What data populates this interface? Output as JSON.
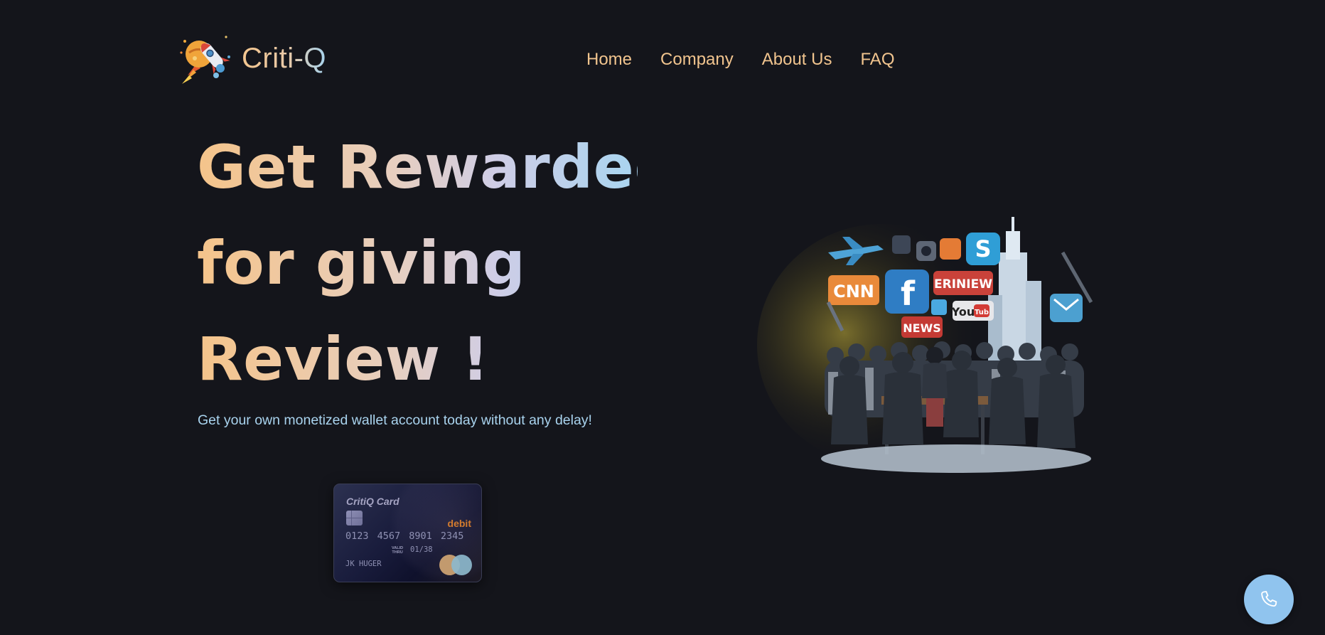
{
  "brand": {
    "name": "Criti-Q",
    "logo_icon": "rocket-logo-icon"
  },
  "nav": {
    "items": [
      {
        "label": "Home"
      },
      {
        "label": "Company"
      },
      {
        "label": "About Us"
      },
      {
        "label": "FAQ"
      }
    ]
  },
  "hero": {
    "title_lines": [
      "Get Rewarded",
      "for giving",
      "Review !"
    ],
    "subtitle": "Get your own monetized wallet account today without any delay!"
  },
  "card": {
    "title": "CritiQ Card",
    "type": "debit",
    "number": "0123 4567 8901 2345",
    "valid_label_line1": "VALID",
    "valid_label_line2": "THRU",
    "valid_thru": "01/38",
    "holder": "JK HUGER"
  },
  "illustration": {
    "signs": [
      "CNN",
      "ERINIEW",
      "NEWS",
      "You",
      "Tub"
    ]
  },
  "call_button": {
    "icon": "phone-icon"
  },
  "colors": {
    "background": "#14151b",
    "accent_peach": "#f1c48e",
    "accent_blue": "#a9d3ee",
    "call_button": "#90c4ee"
  }
}
